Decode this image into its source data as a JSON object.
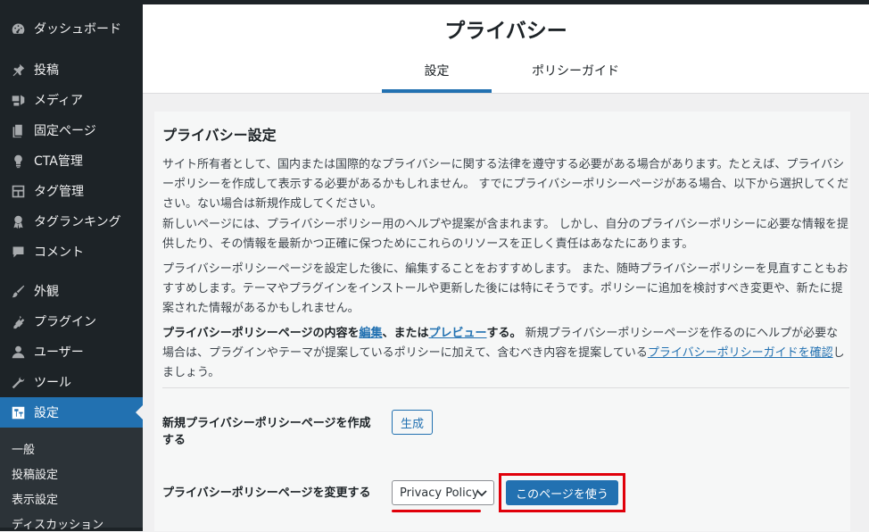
{
  "sidebar": {
    "items": [
      {
        "label": "ダッシュボード",
        "icon": "dashboard-icon"
      },
      {
        "label": "投稿",
        "icon": "pin-icon"
      },
      {
        "label": "メディア",
        "icon": "media-icon"
      },
      {
        "label": "固定ページ",
        "icon": "page-icon"
      },
      {
        "label": "CTA管理",
        "icon": "lightbulb-icon"
      },
      {
        "label": "タグ管理",
        "icon": "layout-icon"
      },
      {
        "label": "タグランキング",
        "icon": "award-icon"
      },
      {
        "label": "コメント",
        "icon": "comment-icon"
      },
      {
        "label": "外観",
        "icon": "brush-icon"
      },
      {
        "label": "プラグイン",
        "icon": "plugin-icon"
      },
      {
        "label": "ユーザー",
        "icon": "user-icon"
      },
      {
        "label": "ツール",
        "icon": "wrench-icon"
      },
      {
        "label": "設定",
        "icon": "settings-icon"
      }
    ],
    "submenu": [
      "一般",
      "投稿設定",
      "表示設定",
      "ディスカッション"
    ]
  },
  "header": {
    "title": "プライバシー",
    "tabs": [
      {
        "label": "設定"
      },
      {
        "label": "ポリシーガイド"
      }
    ]
  },
  "content": {
    "section_title": "プライバシー設定",
    "para1": "サイト所有者として、国内または国際的なプライバシーに関する法律を遵守する必要がある場合があります。たとえば、プライバシーポリシーを作成して表示する必要があるかもしれません。 すでにプライバシーポリシーページがある場合、以下から選択してください。ない場合は新規作成してください。",
    "para2": "新しいページには、プライバシーポリシー用のヘルプや提案が含まれます。 しかし、自分のプライバシーポリシーに必要な情報を提供したり、その情報を最新かつ正確に保つためにこれらのリソースを正しく責任はあなたにあります。",
    "para3": "プライバシーポリシーページを設定した後に、編集することをおすすめします。 また、随時プライバシーポリシーを見直すこともおすすめします。テーマやプラグインをインストールや更新した後には特にそうです。ポリシーに追加を検討すべき変更や、新たに提案された情報があるかもしれません。",
    "para4_prefix": "プライバシーポリシーページの内容を",
    "para4_link_edit": "編集",
    "para4_mid": "、または",
    "para4_link_preview": "プレビュー",
    "para4_suffix": "する。",
    "para4_rest": " 新規プライバシーポリシーページを作るのにヘルプが必要な場合は、プラグインやテーマが提案しているポリシーに加えて、含むべき内容を提案している",
    "para4_link_guide": "プライバシーポリシーガイドを確認",
    "para4_end": "しましょう。",
    "create_label": "新規プライバシーポリシーページを作成する",
    "create_button": "生成",
    "change_label": "プライバシーポリシーページを変更する",
    "select_value": "Privacy Policy",
    "use_button": "このページを使う"
  },
  "colors": {
    "accent": "#2271b1",
    "highlight": "#e0000a",
    "sidebar": "#1d2327"
  }
}
